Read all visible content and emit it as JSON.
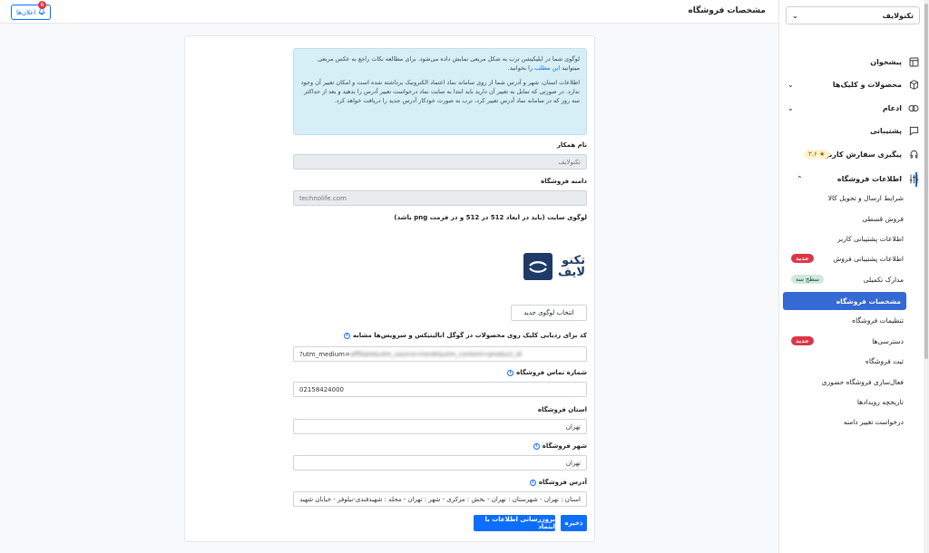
{
  "header": {
    "page_title": "مشخصات فروشگاه",
    "notifications_label": "اعلان‌ها",
    "notifications_count": "6"
  },
  "sidebar": {
    "store_select_value": "تکنولایف",
    "items": [
      {
        "label": "پیشخوان",
        "icon": "layout-icon"
      },
      {
        "label": "محصولات و کلیک‌ها",
        "icon": "box-icon"
      },
      {
        "label": "ادغام",
        "icon": "link-icon"
      },
      {
        "label": "پشتیبانی",
        "icon": "chat-icon"
      },
      {
        "label": "پیگیری سفارش کاربران",
        "icon": "headset-icon",
        "rating": "★ ۳.۶"
      },
      {
        "label": "اطلاعات فروشگاه",
        "icon": "sliders-icon"
      }
    ],
    "sub_items": [
      {
        "label": "شرایط ارسال و تحویل کالا"
      },
      {
        "label": "فروش قسطی"
      },
      {
        "label": "اطلاعات پشتیبانی کاربر"
      },
      {
        "label": "اطلاعات پشتیبانی فروش",
        "badge": "جدید"
      },
      {
        "label": "مدارک تکمیلی",
        "badge": "سطح سه"
      },
      {
        "label": "مشخصات فروشگاه"
      },
      {
        "label": "تنظیمات فروشگاه"
      },
      {
        "label": "دسترسی‌ها",
        "badge": "جدید"
      },
      {
        "label": "ثبت فروشگاه"
      },
      {
        "label": "فعال‌سازی فروشگاه حضوری"
      },
      {
        "label": "تاریخچه رویدادها"
      },
      {
        "label": "درخواست تغییر دامنه"
      }
    ]
  },
  "info": {
    "p1_before": "لوگوی شما در اپلیکیشن ترب به شکل مربعی نمایش داده می‌شود. برای مطالعه نکات راجع به عکس مربعی میتوانید",
    "p1_link": "این مطلب",
    "p1_after": "را بخوانید.",
    "p2": "اطلاعات استان، شهر و آدرس شما از روی سامانه نماد اعتماد الکترونیک برداشته شده است و امکان تغییر آن وجود ندارد. در صورتی که تمایل به تغییر آن دارید باید ابتدا به سایت نماد درخواست تغییر آدرس را بدهید و بعد از حداکثر سه روز که در سامانه نماد آدرس تغییر کرد، ترب به صورت خودکار آدرس جدید را دریافت خواهد کرد."
  },
  "form": {
    "partner_name_label": "نام همکار",
    "partner_name_value": "تکنولایف",
    "domain_label": "دامنه فروشگاه",
    "domain_value": "technolife.com",
    "logo_label": "لوگوی سایت (باید در ابعاد 512 در 512 و در فرمت png باشد)",
    "logo_text_line1": "تکنو",
    "logo_text_line2": "لایف",
    "choose_logo_button": "انتخاب لوگوی جدید",
    "tracking_label": "کد برای ردیابی کلیک روی محصولات در گوگل انالیتیکس و سرویس‌ها مشابه",
    "tracking_value_visible": "?utm_medium=",
    "tracking_value_blurred": "affiliate&utm_source=torob&utm_content=product_id",
    "phone_label": "شماره تماس فروشگاه",
    "phone_value": "02158424000",
    "province_label": "استان فروشگاه",
    "province_value": "تهران",
    "city_label": "شهر فروشگاه",
    "city_value": "تهران",
    "address_label": "آدرس فروشگاه",
    "address_value": "استان : تهران - شهرستان : تهران - بخش : مرکزی - شهر : تهران - محله : شهیدقندی-نیلوفر - خیابان شهید",
    "save_button": "ذخیره",
    "update_button": "بروزرسانی اطلاعات با اینماد"
  }
}
